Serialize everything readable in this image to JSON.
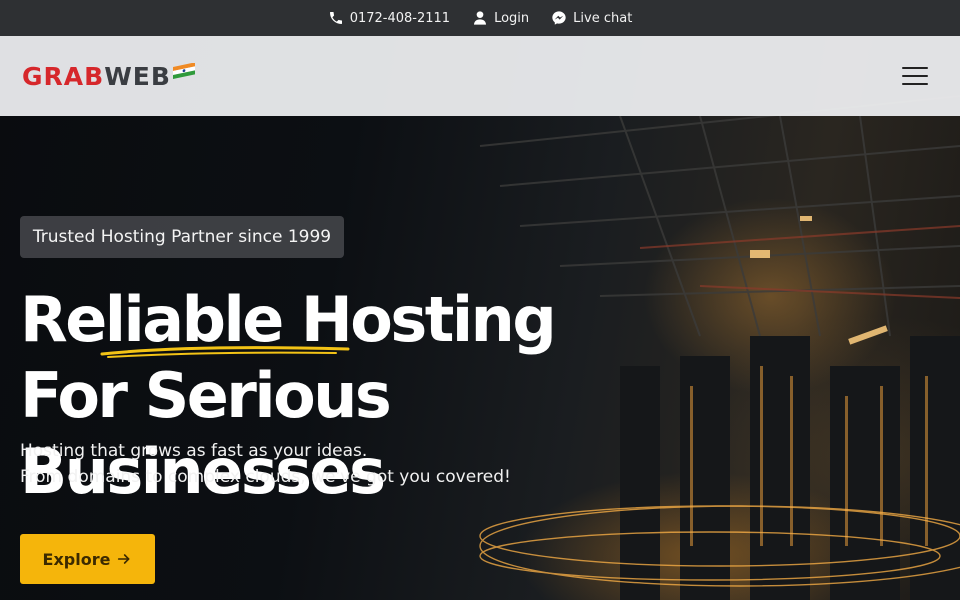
{
  "topbar": {
    "phone": {
      "icon": "phone-icon",
      "label": "0172-408-2111"
    },
    "login": {
      "icon": "user-icon",
      "label": "Login"
    },
    "chat": {
      "icon": "messenger-icon",
      "label": "Live chat"
    }
  },
  "header": {
    "logo": {
      "part1": "GRAB",
      "part2": "WEB",
      "flag": "india-flag-icon"
    },
    "menu_icon": "hamburger-menu-icon"
  },
  "hero": {
    "badge": "Trusted Hosting Partner since 1999",
    "headline_line1": "Reliable Hosting",
    "headline_line2": "For Serious Businesses",
    "sub_line1": "Hosting that grows as fast as your ideas.",
    "sub_line2": "From domains to complex clouds, we've got you covered!",
    "cta_label": "Explore",
    "cta_icon": "arrow-right-icon"
  },
  "colors": {
    "topbar_bg": "#2e3033",
    "brand_red": "#d6272b",
    "brand_gray": "#3a3d42",
    "cta_yellow": "#f5b50b",
    "accent_swoosh": "#f3c316"
  }
}
